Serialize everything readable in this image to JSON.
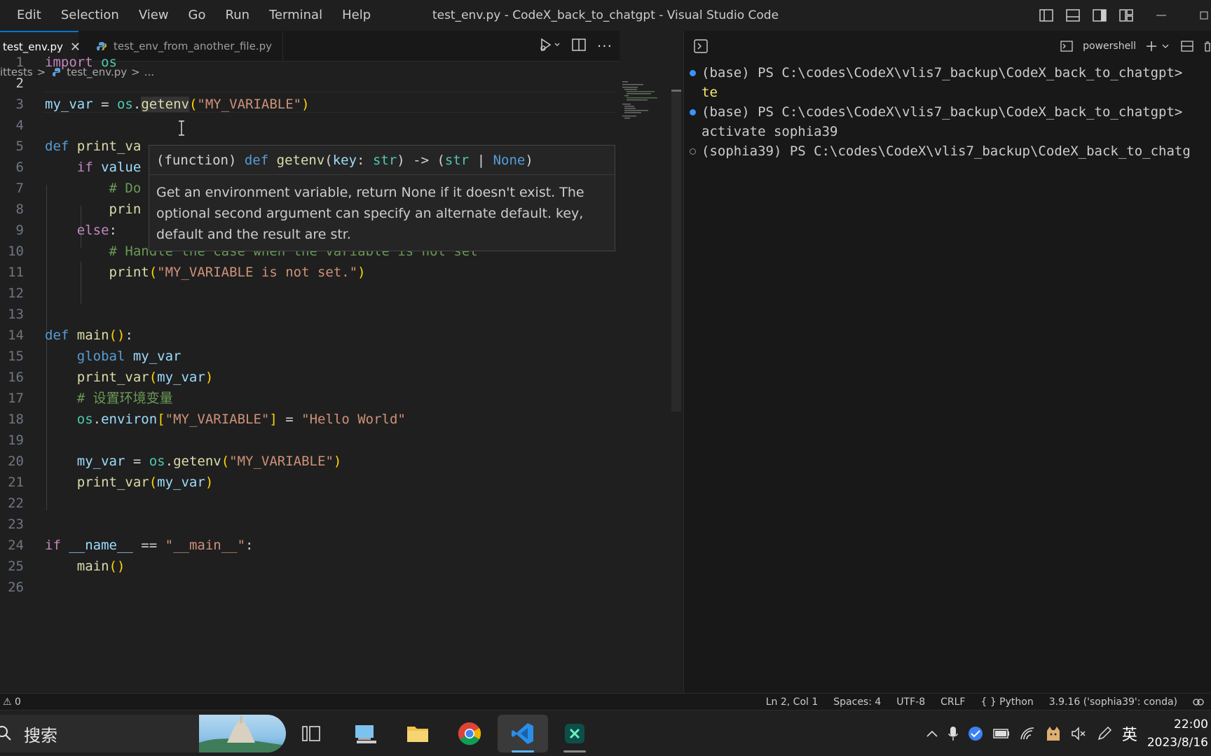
{
  "menu": [
    "Edit",
    "Selection",
    "View",
    "Go",
    "Run",
    "Terminal",
    "Help"
  ],
  "window_title": "test_env.py - CodeX_back_to_chatgpt - Visual Studio Code",
  "tabs": {
    "active": "test_env.py",
    "inactive": "test_env_from_another_file.py",
    "close_glyph": "✕"
  },
  "breadcrumb": {
    "folder": "ittests",
    "sep": ">",
    "file": "test_env.py",
    "more": "..."
  },
  "line_numbers": [
    "1",
    "2",
    "3",
    "4",
    "5",
    "6",
    "7",
    "8",
    "9",
    "10",
    "11",
    "12",
    "13",
    "14",
    "15",
    "16",
    "17",
    "18",
    "19",
    "20",
    "21",
    "22",
    "23",
    "24",
    "25",
    "26"
  ],
  "code": {
    "l1_kw": "import",
    "l1_mod": "os",
    "l3_var": "my_var",
    "l3_op": " = ",
    "l3_mod": "os",
    "l3_dot": ".",
    "l3_fn": "getenv",
    "l3_p1": "(",
    "l3_str": "\"MY_VARIABLE\"",
    "l3_p2": ")",
    "l5_kw": "def",
    "l5_fn": "print_va",
    "l6_kw": "if",
    "l6_var": "value",
    "l7_cmt": "# Do",
    "l8_fn": "prin",
    "l9_kw": "else",
    "l9_colon": ":",
    "l10_cmt": "# Handle the case when the variable is not set",
    "l11_fn": "print",
    "l11_p1": "(",
    "l11_str": "\"MY_VARIABLE is not set.\"",
    "l11_p2": ")",
    "l14_kw": "def",
    "l14_fn": "main",
    "l14_p": "()",
    "l14_colon": ":",
    "l15_kw": "global",
    "l15_var": "my_var",
    "l16_fn": "print_var",
    "l16_p1": "(",
    "l16_var": "my_var",
    "l16_p2": ")",
    "l17_cmt": "# 设置环境变量",
    "l18_mod": "os",
    "l18_dot": ".",
    "l18_var": "environ",
    "l18_b1": "[",
    "l18_str": "\"MY_VARIABLE\"",
    "l18_b2": "]",
    "l18_op": " = ",
    "l18_str2": "\"Hello World\"",
    "l20_var": "my_var",
    "l20_op": " = ",
    "l20_mod": "os",
    "l20_dot": ".",
    "l20_fn": "getenv",
    "l20_p1": "(",
    "l20_str": "\"MY_VARIABLE\"",
    "l20_p2": ")",
    "l21_fn": "print_var",
    "l21_p1": "(",
    "l21_var": "my_var",
    "l21_p2": ")",
    "l24_kw": "if",
    "l24_var": "__name__",
    "l24_op": " == ",
    "l24_str": "\"__main__\"",
    "l24_colon": ":",
    "l25_fn": "main",
    "l25_p": "()"
  },
  "hover": {
    "sig_prefix": "(function) ",
    "sig_def": "def",
    "sig_name": "getenv",
    "sig_p1": "(",
    "sig_param": "key",
    "sig_colon": ": ",
    "sig_type": "str",
    "sig_p2": ")",
    "sig_arrow": " -> (",
    "sig_ret": "str",
    "sig_bar": " | ",
    "sig_none": "None",
    "sig_p3": ")",
    "doc": "Get an environment variable, return None if it doesn't exist. The optional second argument can specify an alternate default. key, default and the result are str."
  },
  "terminal": {
    "profile": "powershell",
    "lines": [
      {
        "text": "(base) PS C:\\codes\\CodeX\\vlis7_backup\\CodeX_back_to_chatgpt>",
        "dot": "blue"
      },
      {
        "text": "te",
        "dot": "none"
      },
      {
        "text": "(base) PS C:\\codes\\CodeX\\vlis7_backup\\CodeX_back_to_chatgpt>",
        "dot": "blue"
      },
      {
        "text": "activate sophia39",
        "dot": "none"
      },
      {
        "text": "(sophia39) PS C:\\codes\\CodeX\\vlis7_backup\\CodeX_back_to_chatg",
        "dot": "hollow"
      }
    ]
  },
  "status": {
    "problems": "⚠ 0",
    "position": "Ln 2, Col 1",
    "spaces": "Spaces: 4",
    "encoding": "UTF-8",
    "eol": "CRLF",
    "language": "{ } Python",
    "interpreter": "3.9.16 ('sophia39': conda)"
  },
  "taskbar": {
    "search_placeholder": "搜索",
    "ime": "英",
    "time": "22:00",
    "date": "2023/8/16"
  },
  "colors": {
    "accent": "#0078d4",
    "keyword": "#569cd6",
    "function": "#dcdcaa",
    "string": "#ce9178",
    "comment": "#6a9955"
  }
}
